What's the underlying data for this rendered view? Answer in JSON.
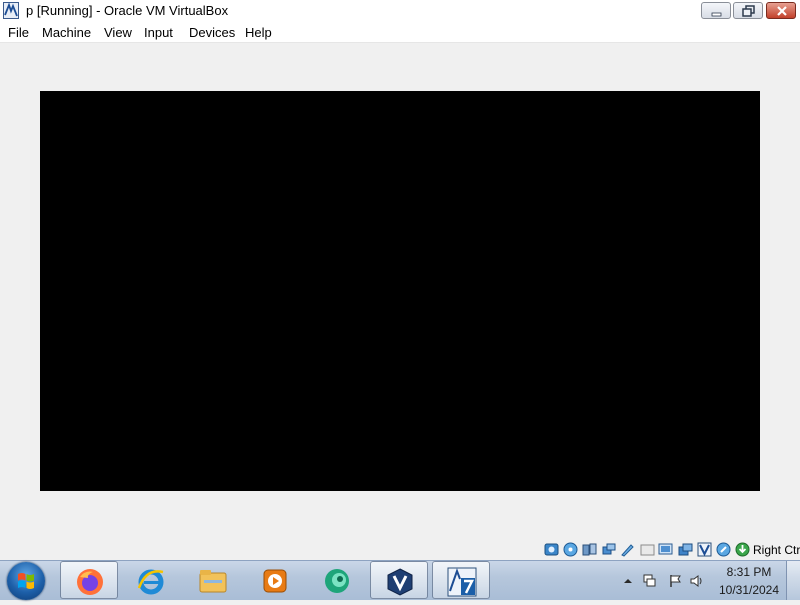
{
  "window": {
    "title": "p [Running] - Oracle VM VirtualBox",
    "app_icon": "virtualbox-icon",
    "controls": [
      "minimize-icon",
      "maximize-icon",
      "close-icon"
    ]
  },
  "menubar": {
    "items": [
      {
        "label": "File"
      },
      {
        "label": "Machine"
      },
      {
        "label": "View"
      },
      {
        "label": "Input"
      },
      {
        "label": "Devices"
      },
      {
        "label": "Help"
      }
    ]
  },
  "statusbar": {
    "icons": [
      "hard-disk-icon",
      "optical-drive-icon",
      "audio-icon",
      "network-icon",
      "usb-icon",
      "shared-folders-icon",
      "display-icon",
      "recording-icon",
      "virtualization-icon",
      "mouse-integration-icon",
      "keyboard-icon"
    ],
    "host_key": "Right Ctrl"
  },
  "taskbar": {
    "apps": [
      "firefox-icon",
      "internet-explorer-icon",
      "file-explorer-icon",
      "media-player-icon",
      "app-icon",
      "virtualbox-icon",
      "windows7-vm-icon"
    ],
    "tray_icons": [
      "show-hidden-icons-icon",
      "network-tray-icon",
      "action-center-icon",
      "volume-icon"
    ],
    "clock": {
      "time": "8:31 PM",
      "date": "10/31/2024"
    }
  }
}
